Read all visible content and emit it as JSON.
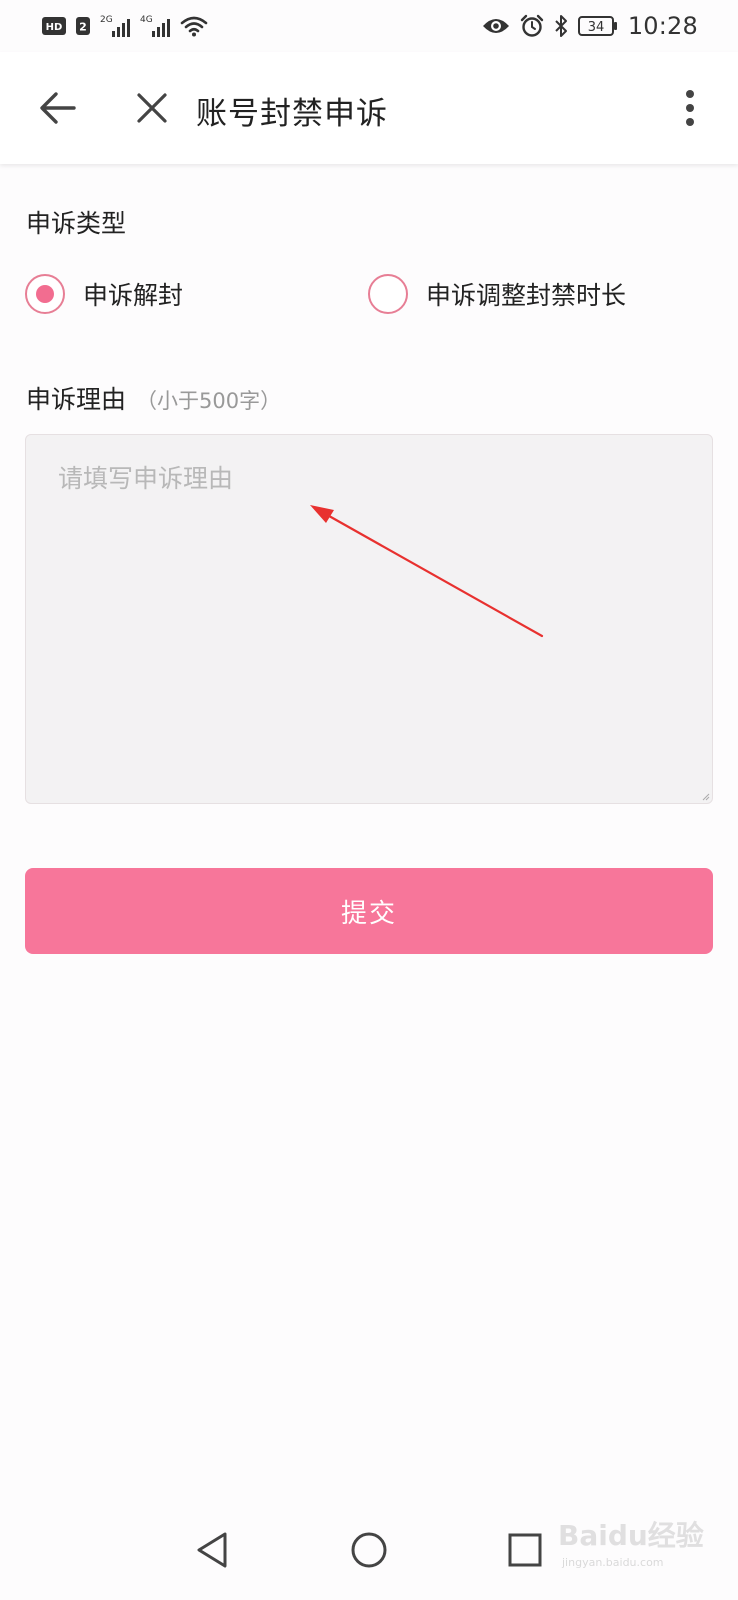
{
  "status_bar": {
    "left_icons": [
      "hd-icon",
      "sim2-badge",
      "signal-2g-icon",
      "signal-4g-icon",
      "wifi-icon"
    ],
    "hd_label": "HD",
    "sim_label": "2",
    "net1_label": "2G",
    "net2_label": "4G",
    "right_icons": [
      "eye-icon",
      "alarm-icon",
      "bluetooth-icon",
      "battery-icon"
    ],
    "battery": "34",
    "time": "10:28"
  },
  "app_bar": {
    "title": "账号封禁申诉",
    "icons": {
      "back": "arrow-left-icon",
      "close": "close-icon",
      "more": "more-vertical-icon"
    }
  },
  "form": {
    "type_label": "申诉类型",
    "options": [
      {
        "label": "申诉解封",
        "selected": true
      },
      {
        "label": "申诉调整封禁时长",
        "selected": false
      }
    ],
    "reason_label": "申诉理由",
    "reason_hint": "（小于500字）",
    "reason_placeholder": "请填写申诉理由",
    "reason_value": "",
    "submit_label": "提交"
  },
  "nav_bar": {
    "icons": [
      "triangle-back-icon",
      "circle-home-icon",
      "square-recent-icon"
    ]
  },
  "watermark": {
    "main": "Baidu经验",
    "sub": "jingyan.baidu.com"
  },
  "colors": {
    "accent": "#f7769a",
    "radio_border": "#e77e95",
    "radio_dot": "#f26d90",
    "arrow": "#e8312f",
    "textarea_bg": "#f3f2f3"
  }
}
